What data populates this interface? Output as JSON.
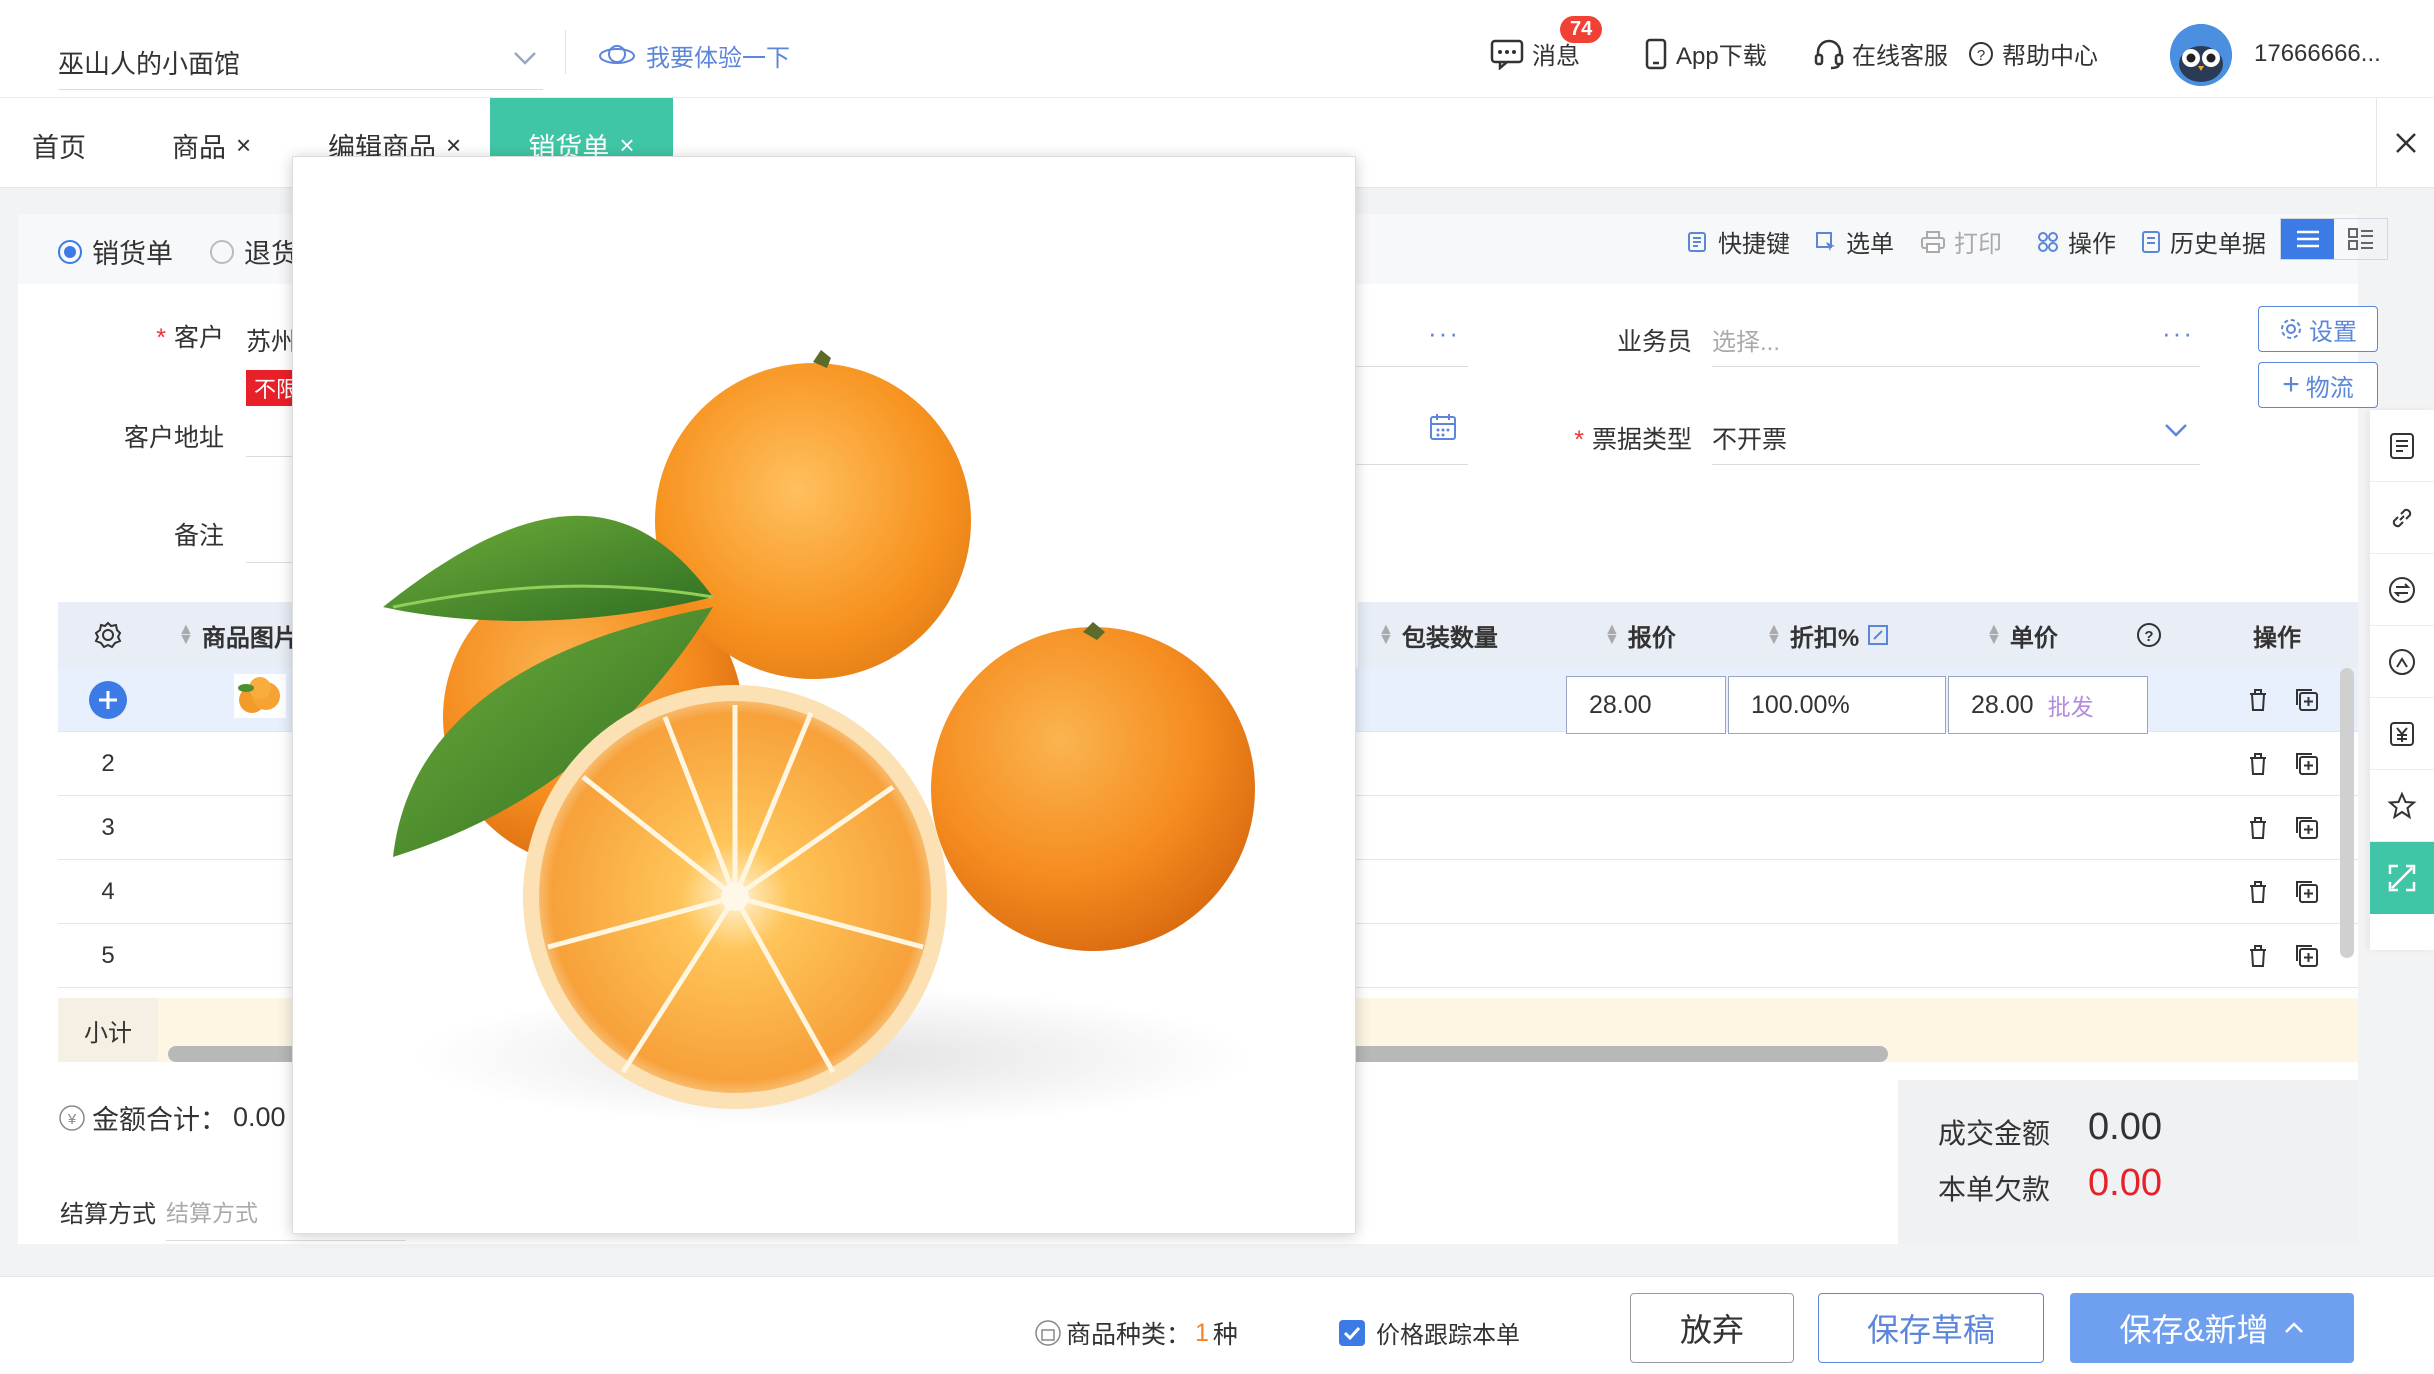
{
  "header": {
    "shop_name": "巫山人的小面馆",
    "try_link": "我要体验一下",
    "messages_label": "消息",
    "messages_badge": "74",
    "app_download": "App下载",
    "online_service": "在线客服",
    "help_center": "帮助中心",
    "phone": "17666666..."
  },
  "tabs": [
    {
      "label": "首页"
    },
    {
      "label": "商品"
    },
    {
      "label": "编辑商品"
    },
    {
      "label": "销货单"
    }
  ],
  "doc_type": {
    "sales": "销货单",
    "returns": "退货"
  },
  "toolbar": {
    "shortcuts": "快捷键",
    "select": "选单",
    "print": "打印",
    "operations": "操作",
    "history": "历史单据"
  },
  "form": {
    "customer_label": "客户",
    "customer_value": "苏州",
    "customer_tag": "不限",
    "address_label": "客户地址",
    "remark_label": "备注",
    "salesman_label": "业务员",
    "salesman_placeholder": "选择...",
    "invoice_label": "票据类型",
    "invoice_value": "不开票",
    "settings_btn": "设置",
    "logistics_btn": "物流"
  },
  "table": {
    "headers": {
      "image": "商品图片",
      "pack_qty": "包装数量",
      "quote": "报价",
      "discount": "折扣%",
      "unit_price": "单价",
      "ops": "操作"
    },
    "row1": {
      "quote": "28.00",
      "discount": "100.00%",
      "unit_price": "28.00",
      "price_tag": "批发"
    },
    "row_numbers": [
      "2",
      "3",
      "4",
      "5"
    ],
    "subtotal_label": "小计"
  },
  "summary": {
    "amount_total_label": "金额合计：",
    "amount_total_value": "0.00",
    "settle_label": "结算方式",
    "settle_placeholder": "结算方式",
    "deal_amount_label": "成交金额",
    "deal_amount_value": "0.00",
    "debt_label": "本单欠款",
    "debt_value": "0.00"
  },
  "footer": {
    "kinds_label": "商品种类：",
    "kinds_count": "1",
    "kinds_unit": "种",
    "price_track": "价格跟踪本单",
    "discard": "放弃",
    "save_draft": "保存草稿",
    "save_new": "保存&新增"
  },
  "colors": {
    "accent": "#3c7be6",
    "tab_active": "#40c6a6",
    "danger": "#f04134",
    "debt_red": "#e8202a"
  }
}
